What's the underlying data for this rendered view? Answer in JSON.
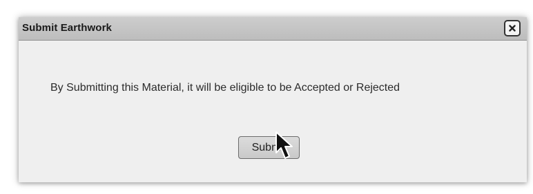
{
  "dialog": {
    "title": "Submit Earthwork",
    "close_icon": "close-icon",
    "message": "By Submitting this Material, it will be eligible to be Accepted or Rejected",
    "submit_label": "Submit"
  },
  "cursor": {
    "icon": "mouse-pointer-icon"
  },
  "colors": {
    "dialog_bg": "#efefef",
    "title_bar": "#c6c6c6",
    "button_bg": "#d3d3d3"
  }
}
